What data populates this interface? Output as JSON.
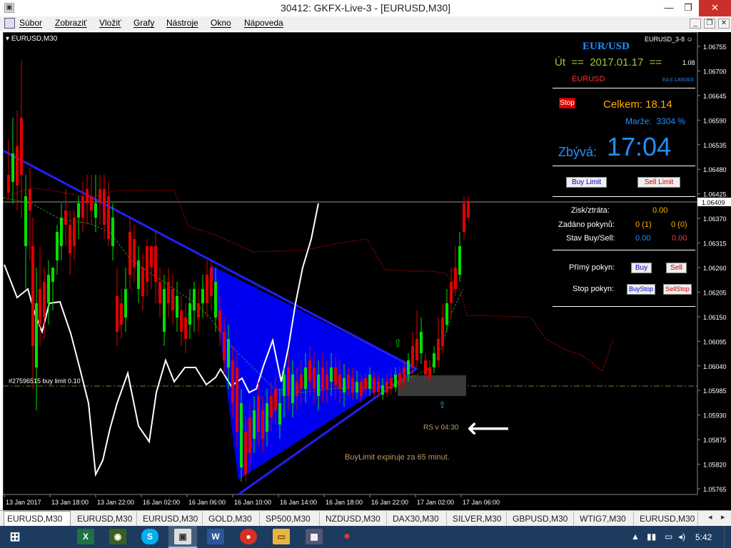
{
  "window": {
    "title": "30412: GKFX-Live-3 - [EURUSD,M30]",
    "minimize": "—",
    "maximize": "❐",
    "close": "✕"
  },
  "menu": [
    "Súbor",
    "Zobraziť",
    "Vložiť",
    "Grafy",
    "Nástroje",
    "Okno",
    "Nápoveda"
  ],
  "chart": {
    "symbol_label": "EURUSD,M30",
    "indicator_label": "EURUSD_3-8",
    "order_line_label": "#27596515 buy limit 0.10",
    "rs_label": "RS v 04:30",
    "expiry_label": "BuyLimit expiruje za 65 minut.",
    "current_price": "1.06409",
    "price_ticks": [
      "1.06755",
      "1.06700",
      "1.06645",
      "1.06590",
      "1.06535",
      "1.06480",
      "1.06425",
      "1.06370",
      "1.06315",
      "1.06260",
      "1.06205",
      "1.06150",
      "1.06095",
      "1.06040",
      "1.05985",
      "1.05930",
      "1.05875",
      "1.05820",
      "1.05765"
    ],
    "time_ticks": [
      "13 Jan 2017",
      "13 Jan 18:00",
      "13 Jan 22:00",
      "16 Jan 02:00",
      "16 Jan 06:00",
      "16 Jan 10:00",
      "16 Jan 14:00",
      "16 Jan 18:00",
      "16 Jan 22:00",
      "17 Jan 02:00",
      "17 Jan 06:00"
    ]
  },
  "panel": {
    "pair": "EUR/USD",
    "day": "Út",
    "sep1": "==",
    "date": "2017.01.17",
    "sep2": "==",
    "version": "1.08",
    "symbol": "EURUSD",
    "ea_number": "EA č.1300303",
    "stop_button": "Stop",
    "celkem": "Celkem: 18.14",
    "marze_label": "Marže:",
    "marze_value": "3304 %",
    "zbyva_label": "Zbývá:",
    "zbyva_value": "17:04",
    "buy_limit": "Buy Limit",
    "sell_limit": "Sell Limit",
    "zisk_label": "Zisk/ztráta:",
    "zisk_value": "0.00",
    "zadano_label": "Zadáno pokynů:",
    "zadano_buy": "0 (1)",
    "zadano_sell": "0 (0)",
    "stav_label": "Stav Buy/Sell:",
    "stav_buy": "0.00",
    "stav_sell": "0.00",
    "primy_label": "Přímý pokyn:",
    "buy": "Buy",
    "sell": "Sell",
    "stop_label": "Stop pokyn:",
    "buystop": "BuyStop",
    "sellstop": "SellStop"
  },
  "tabs": [
    "EURUSD,M30",
    "EURUSD,M30",
    "EURUSD,M30",
    "GOLD,M30",
    "SP500,M30",
    "NZDUSD,M30",
    "DAX30,M30",
    "SILVER,M30",
    "GBPUSD,M30",
    "WTIG7,M30",
    "EURUSD,M30"
  ],
  "taskbar": {
    "clock": "5:42",
    "apps": [
      "windows-icon",
      "excel-icon",
      "metatrader-icon",
      "skype-icon",
      "gkfx-icon",
      "word-icon",
      "chrome-icon",
      "explorer-icon",
      "terminal-icon",
      "app-icon"
    ]
  },
  "colors": {
    "bull": "#00e000",
    "bear": "#e00000",
    "triangle": "#0000ff",
    "trend": "#2020ff",
    "panel_blue": "#1e90ff",
    "panel_gold": "#ffb000"
  }
}
